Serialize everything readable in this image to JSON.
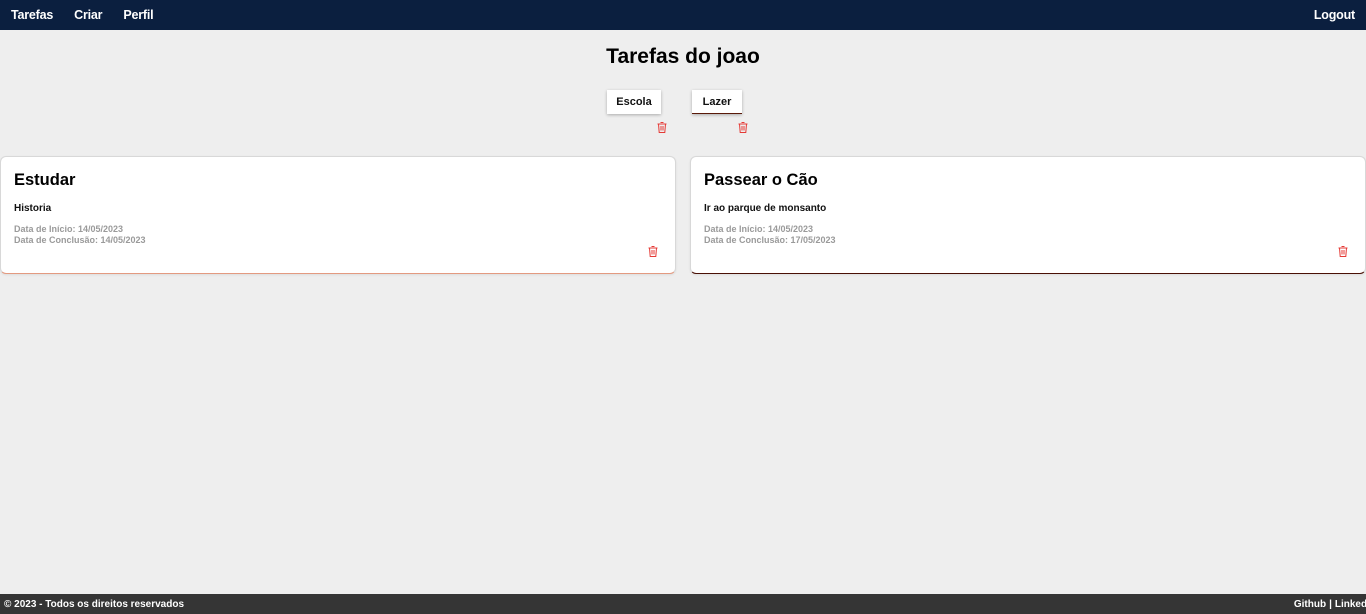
{
  "nav": {
    "links": [
      "Tarefas",
      "Criar",
      "Perfil"
    ],
    "logout": "Logout"
  },
  "page": {
    "title": "Tarefas do joao"
  },
  "categories": [
    {
      "label": "Escola"
    },
    {
      "label": "Lazer"
    }
  ],
  "tasks": [
    {
      "title": "Estudar",
      "description": "Historia",
      "start": "Data de Início: 14/05/2023",
      "end": "Data de Conclusão: 14/05/2023"
    },
    {
      "title": "Passear o Cão",
      "description": "Ir ao parque de monsanto",
      "start": "Data de Início: 14/05/2023",
      "end": "Data de Conclusão: 17/05/2023"
    }
  ],
  "footer": {
    "copyright": "© 2023 - Todos os direitos reservados",
    "github": "Github",
    "separator": "|",
    "linkedin": "LinkedIn"
  },
  "colors": {
    "navbar": "#0b1f3f",
    "background": "#eeeeee",
    "footer": "#353535",
    "trash": "#e53935"
  },
  "icons": {
    "delete": "trash-icon"
  }
}
